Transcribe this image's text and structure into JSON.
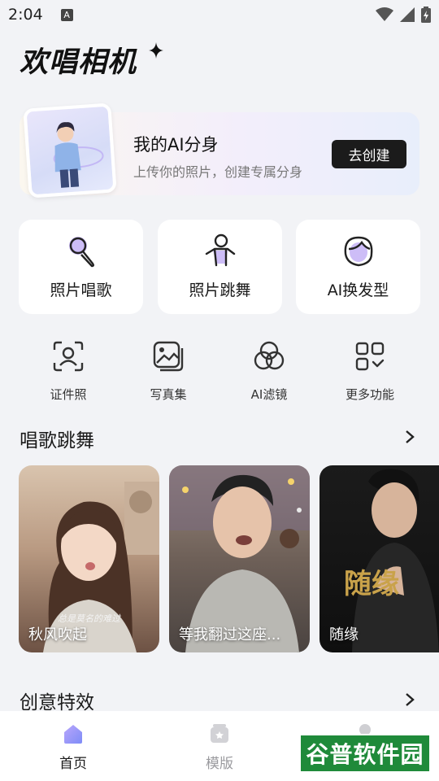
{
  "status_bar": {
    "time": "2:04",
    "notification_icon": "A"
  },
  "app": {
    "title": "欢唱相机"
  },
  "banner": {
    "title": "我的AI分身",
    "subtitle": "上传你的照片，创建专属分身",
    "button_label": "去创建"
  },
  "features": [
    {
      "label": "照片唱歌",
      "icon": "microphone-icon"
    },
    {
      "label": "照片跳舞",
      "icon": "dancer-icon"
    },
    {
      "label": "AI换发型",
      "icon": "hairstyle-icon"
    }
  ],
  "tools": [
    {
      "label": "证件照",
      "icon": "id-photo-icon"
    },
    {
      "label": "写真集",
      "icon": "photo-album-icon"
    },
    {
      "label": "AI滤镜",
      "icon": "filter-icon"
    },
    {
      "label": "更多功能",
      "icon": "more-grid-icon"
    }
  ],
  "section_sing_dance": {
    "title": "唱歌跳舞",
    "videos": [
      {
        "title": "秋风吹起",
        "caption": "总是莫名的难过"
      },
      {
        "title": "等我翻过这座..."
      },
      {
        "title": "随缘",
        "overlay_text": "随缘"
      }
    ]
  },
  "section_effects": {
    "title": "创意特效"
  },
  "bottom_nav": {
    "items": [
      {
        "label": "首页",
        "active": true
      },
      {
        "label": "模版",
        "active": false
      }
    ]
  },
  "watermark": {
    "text": "谷普软件园"
  },
  "colors": {
    "accent": "#8b7cf6",
    "banner_button": "#1b1b1b",
    "watermark": "#1f8a3a"
  }
}
